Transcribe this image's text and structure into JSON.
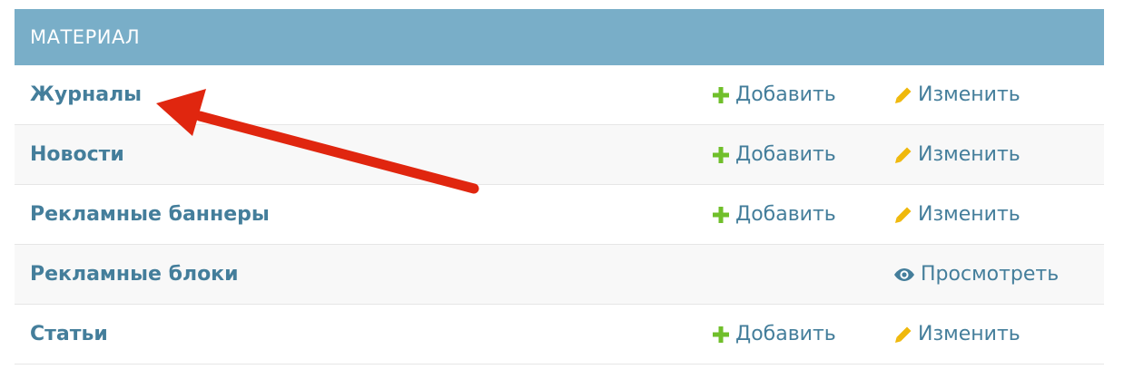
{
  "module": {
    "title": "МАТЕРИАЛ",
    "header_color": "#79aec8",
    "link_color": "#447e9b",
    "rows": [
      {
        "name": "Журналы",
        "add_label": "Добавить",
        "change_label": "Изменить"
      },
      {
        "name": "Новости",
        "add_label": "Добавить",
        "change_label": "Изменить"
      },
      {
        "name": "Рекламные баннеры",
        "add_label": "Добавить",
        "change_label": "Изменить"
      },
      {
        "name": "Рекламные блоки",
        "view_label": "Просмотреть"
      },
      {
        "name": "Статьи",
        "add_label": "Добавить",
        "change_label": "Изменить"
      }
    ]
  },
  "icons": {
    "add": "plus-icon",
    "change": "pencil-icon",
    "view": "eye-icon"
  },
  "annotation": {
    "color": "#e0260f",
    "shape": "arrow pointing to Журналы"
  }
}
